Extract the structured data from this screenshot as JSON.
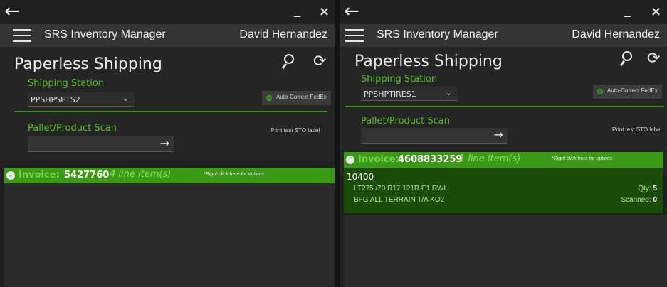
{
  "left": {
    "window": {
      "back_icon": "arrow-left-icon",
      "minimize": "_",
      "close": "×"
    },
    "appbar": {
      "menu_icon": "hamburger-icon",
      "title": "SRS Inventory Manager",
      "user": "David Hernandez"
    },
    "page": {
      "title": "Paperless Shipping",
      "search_icon": "search-icon",
      "refresh_icon": "refresh-icon",
      "refresh_glyph": "⟳"
    },
    "station": {
      "label": "Shipping Station",
      "value": "PPSHPSETS2",
      "chevron": "⌄"
    },
    "autocorrect": {
      "label": "Auto-Correct FedEx"
    },
    "scan": {
      "label": "Pallet/Product Scan",
      "value": "",
      "submit_glyph": "→"
    },
    "print": {
      "label": "Print test STO label"
    },
    "invoice": {
      "label": "Invoice:",
      "number": "5427760",
      "items": "4 line item(s)",
      "hint": "*Right click here for options",
      "caret": "⌄"
    }
  },
  "right": {
    "window": {
      "back_icon": "arrow-left-icon",
      "minimize": "_",
      "close": "×"
    },
    "appbar": {
      "menu_icon": "hamburger-icon",
      "title": "SRS Inventory Manager",
      "user": "David Hernandez"
    },
    "page": {
      "title": "Paperless Shipping",
      "search_icon": "search-icon",
      "refresh_icon": "refresh-icon",
      "refresh_glyph": "⟳"
    },
    "station": {
      "label": "Shipping Station",
      "value": "PPSHPTIRES1",
      "chevron": "⌄"
    },
    "autocorrect": {
      "label": "Auto-Correct FedEx"
    },
    "scan": {
      "label": "Pallet/Product Scan",
      "value": "",
      "submit_glyph": "→"
    },
    "print": {
      "label": "Print test STO label"
    },
    "invoice": {
      "label": "Invoice:",
      "number": "4608833259",
      "items": "1 line item(s)",
      "hint": "*Right click here for options",
      "caret": "^"
    },
    "line_item": {
      "order": "10400",
      "desc1": "LT275 /70  R17  121R E1 RWL",
      "desc2": "BFG  ALL TERRAIN T/A KO2",
      "qty_label": "Qty:",
      "qty": "5",
      "scanned_label": "Scanned:",
      "scanned": "0"
    }
  },
  "colors": {
    "accent": "#3a9a16",
    "label_green": "#53c21f",
    "background": "#202020",
    "appbar": "#343434"
  }
}
